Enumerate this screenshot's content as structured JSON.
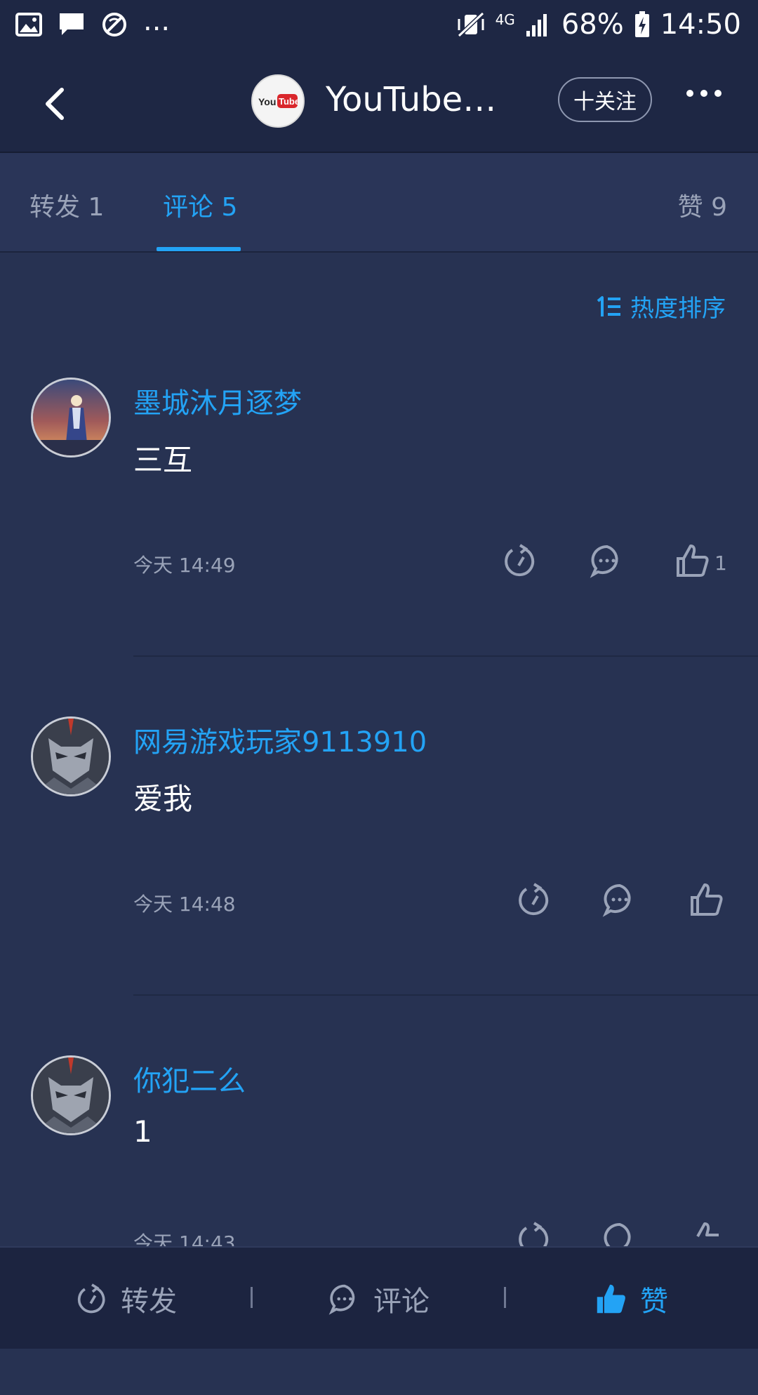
{
  "status_bar": {
    "battery": "68%",
    "time": "14:50",
    "network": "4G",
    "more_indicator": "..."
  },
  "header": {
    "title": "YouTube…",
    "follow_label": "十关注",
    "logo_text": "You Tube"
  },
  "tabs": [
    {
      "label": "转发 1"
    },
    {
      "label": "评论 5"
    },
    {
      "label": "赞 9"
    }
  ],
  "sort_label": "热度排序",
  "comments": [
    {
      "user": "墨城沐月逐梦",
      "text": "三互",
      "time": "今天 14:49",
      "likes": "1"
    },
    {
      "user": "网易游戏玩家9113910",
      "text": "爱我",
      "time": "今天 14:48",
      "likes": ""
    },
    {
      "user": "你犯二么",
      "text": "1",
      "time": "今天 14:43",
      "likes": ""
    }
  ],
  "bottom_bar": {
    "repost": "转发",
    "comment": "评论",
    "like": "赞"
  },
  "colors": {
    "accent": "#23a3f5",
    "background": "#273252",
    "header": "#1e2744"
  },
  "icons": [
    "back-icon",
    "more-icon",
    "sort-icon",
    "repost-icon",
    "comment-icon",
    "like-icon"
  ]
}
